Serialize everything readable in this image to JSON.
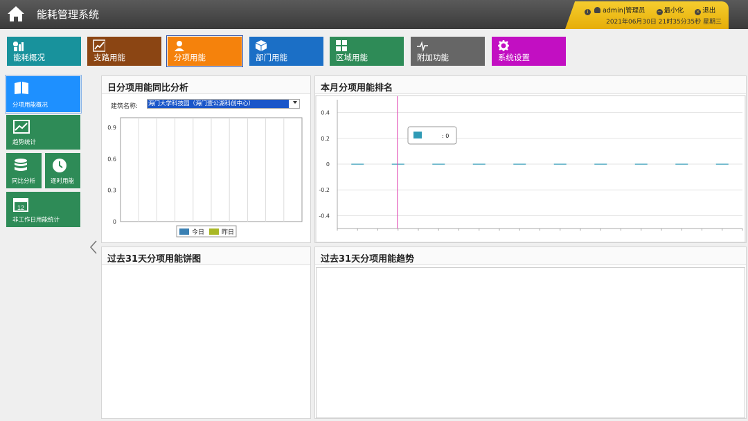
{
  "app": {
    "title": "能耗管理系统"
  },
  "user": {
    "name": "admin",
    "role": "|管理员",
    "minimize": "最小化",
    "logout": "退出",
    "datetime": "2021年06月30日 21时35分35秒 星期三"
  },
  "nav": [
    {
      "label": "能耗概况",
      "color": "#18929c",
      "icon": "energy-icon"
    },
    {
      "label": "支路用能",
      "color": "#8b4513",
      "icon": "branch-chart-icon"
    },
    {
      "label": "分项用能",
      "color": "#f5820c",
      "icon": "person-icon"
    },
    {
      "label": "部门用能",
      "color": "#1b6fc6",
      "icon": "cube-icon"
    },
    {
      "label": "区域用能",
      "color": "#2e8b57",
      "icon": "grid-icon"
    },
    {
      "label": "附加功能",
      "color": "#666666",
      "icon": "pulse-icon"
    },
    {
      "label": "系统设置",
      "color": "#c20fc2",
      "icon": "gear-icon"
    }
  ],
  "side": [
    {
      "label": "分项用能概况",
      "icon": "book-icon"
    },
    {
      "label": "趋势统计",
      "icon": "trend-icon"
    },
    {
      "label": "同比分析",
      "icon": "database-icon"
    },
    {
      "label": "逐时用能",
      "icon": "clock-icon"
    },
    {
      "label": "非工作日用能统计",
      "icon": "calendar-icon"
    }
  ],
  "panels": {
    "daily": {
      "title": "日分项用能同比分析",
      "building_label": "建筑名称:",
      "building_value": "海门大学科技园（海门壹公湖科创中心）"
    },
    "ranking": {
      "title": "本月分项用能排名",
      "tooltip_value": ": 0"
    },
    "pie": {
      "title": "过去31天分项用能饼图"
    },
    "trend": {
      "title": "过去31天分项用能趋势"
    }
  },
  "chart_data": [
    {
      "type": "bar",
      "title": "日分项用能同比分析",
      "ylim": [
        0,
        0.9
      ],
      "yticks": [
        "0.9",
        "0.6",
        "0.3",
        "0"
      ],
      "series": [
        {
          "name": "今日",
          "color": "#3a80b3",
          "values": []
        },
        {
          "name": "昨日",
          "color": "#a9b825",
          "values": []
        }
      ],
      "legend": "bottom"
    },
    {
      "type": "bar",
      "title": "本月分项用能排名",
      "ylim": [
        -0.5,
        0.5
      ],
      "yticks": [
        "0.4",
        "0.2",
        "0",
        "-0.2",
        "-0.4"
      ],
      "values": [
        0,
        0,
        0,
        0,
        0,
        0,
        0,
        0,
        0,
        0
      ],
      "series_color": "#2f9ab5",
      "tooltip": ": 0"
    }
  ],
  "icons": {
    "collapse": "chevron-left-icon",
    "home": "home-icon"
  }
}
